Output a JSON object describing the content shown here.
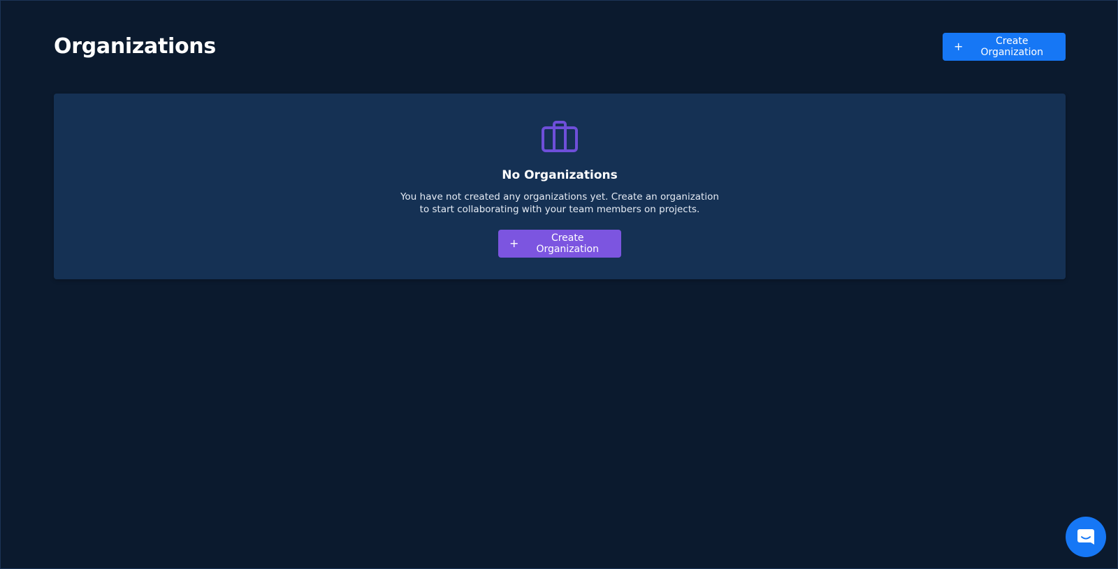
{
  "header": {
    "title": "Organizations",
    "create_button_label": "Create Organization"
  },
  "empty_state": {
    "icon": "briefcase-icon",
    "title": "No Organizations",
    "description": "You have not created any organizations yet. Create an organization to start collaborating with your team members on projects.",
    "create_button_label": "Create Organization"
  },
  "chat_launcher": {
    "icon": "chat-bubble-icon"
  },
  "colors": {
    "background": "#0b1a2e",
    "card": "#153154",
    "primary": "#1677f5",
    "accent": "#7c55e0",
    "icon": "#6e4fd9"
  }
}
